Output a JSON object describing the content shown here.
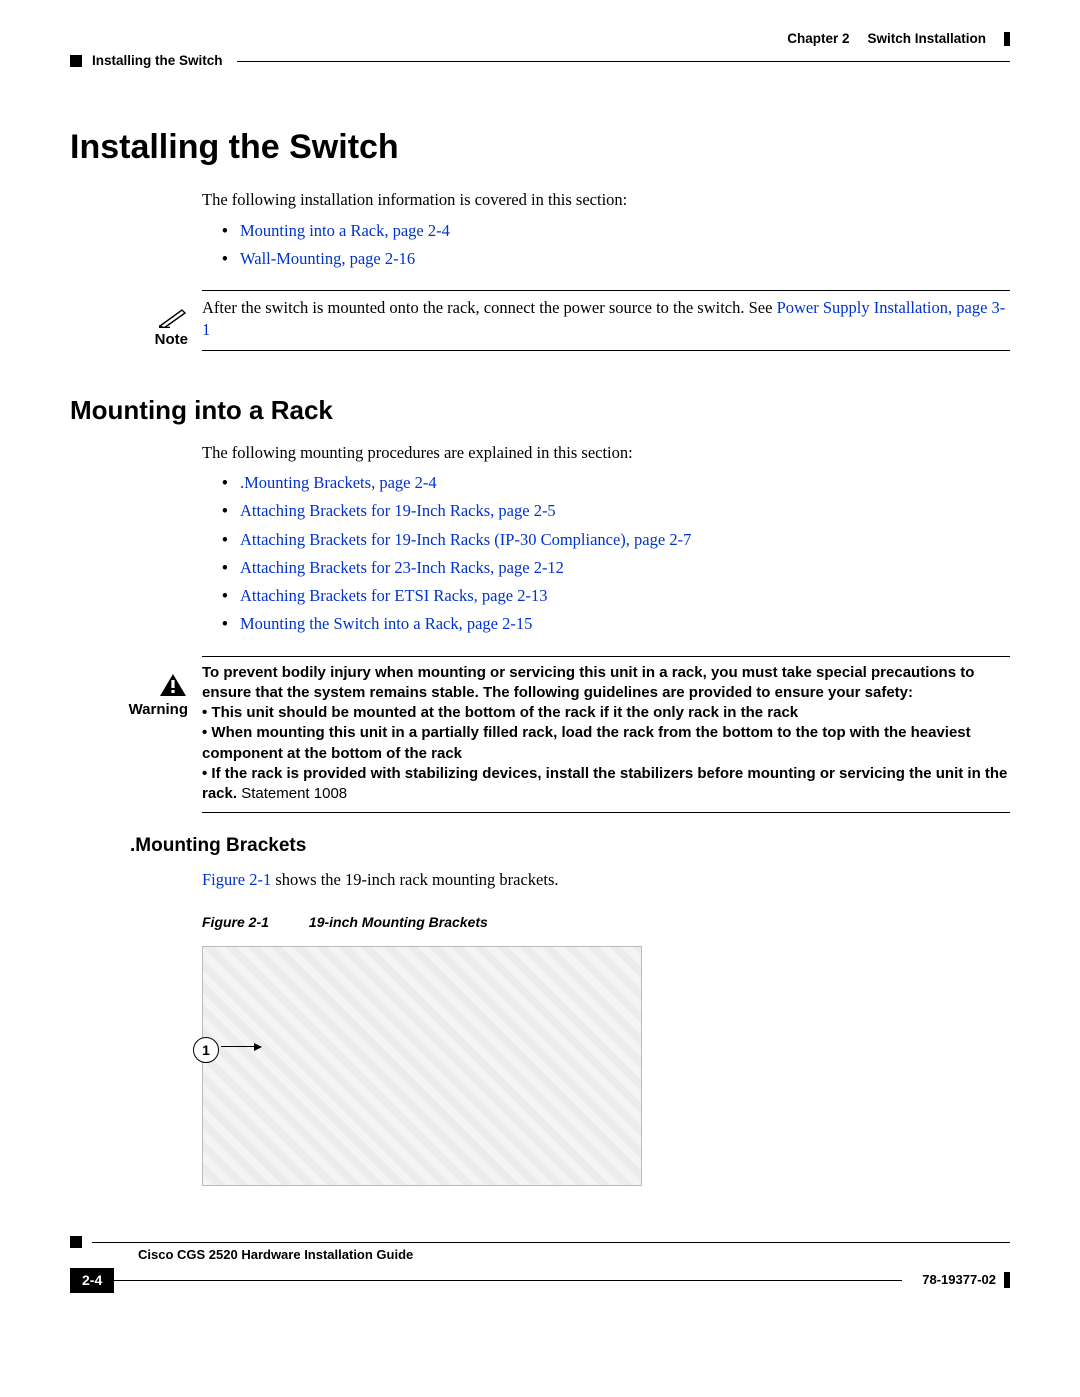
{
  "header": {
    "chapter_label": "Chapter 2",
    "chapter_title": "Switch Installation",
    "section_title": "Installing the Switch"
  },
  "h1": "Installing the Switch",
  "intro1": "The following installation information is covered in this section:",
  "links1": [
    "Mounting into a Rack, page 2-4",
    "Wall-Mounting, page 2-16"
  ],
  "note": {
    "label": "Note",
    "text_before": "After the switch is mounted onto the rack, connect the power source to the switch. See ",
    "link": "Power Supply Installation, page 3-1"
  },
  "h2": "Mounting into a Rack",
  "intro2": "The following mounting procedures are explained in this section:",
  "links2": [
    ".Mounting Brackets, page 2-4",
    "Attaching Brackets for 19-Inch Racks, page 2-5",
    "Attaching Brackets for 19-Inch Racks (IP-30 Compliance), page 2-7",
    "Attaching Brackets for 23-Inch Racks, page 2-12",
    "Attaching Brackets for ETSI Racks, page 2-13",
    "Mounting the Switch into a Rack, page 2-15"
  ],
  "warning": {
    "label": "Warning",
    "lead": "To prevent bodily injury when mounting or servicing this unit in a rack, you must take special precautions to ensure that the system remains stable. The following guidelines are provided to ensure your safety:",
    "b1": "• This unit should be mounted at the bottom of the rack if it the only rack in the rack",
    "b2": "• When mounting this unit in a partially filled rack, load the rack from the bottom to the top with the heaviest component at the bottom of the rack",
    "b3a": "• If the rack is provided with stabilizing devices, install the stabilizers before mounting or servicing the unit in the rack.",
    "stmt": " Statement 1008"
  },
  "h3": ".Mounting Brackets",
  "fig_intro_link": "Figure 2-1",
  "fig_intro_rest": " shows the 19-inch rack mounting brackets.",
  "fig_caption_num": "Figure 2-1",
  "fig_caption_title": "19-inch Mounting Brackets",
  "fig_callout": "1",
  "footer": {
    "doc_title": "Cisco CGS 2520 Hardware Installation Guide",
    "page": "2-4",
    "pub": "78-19377-02"
  }
}
